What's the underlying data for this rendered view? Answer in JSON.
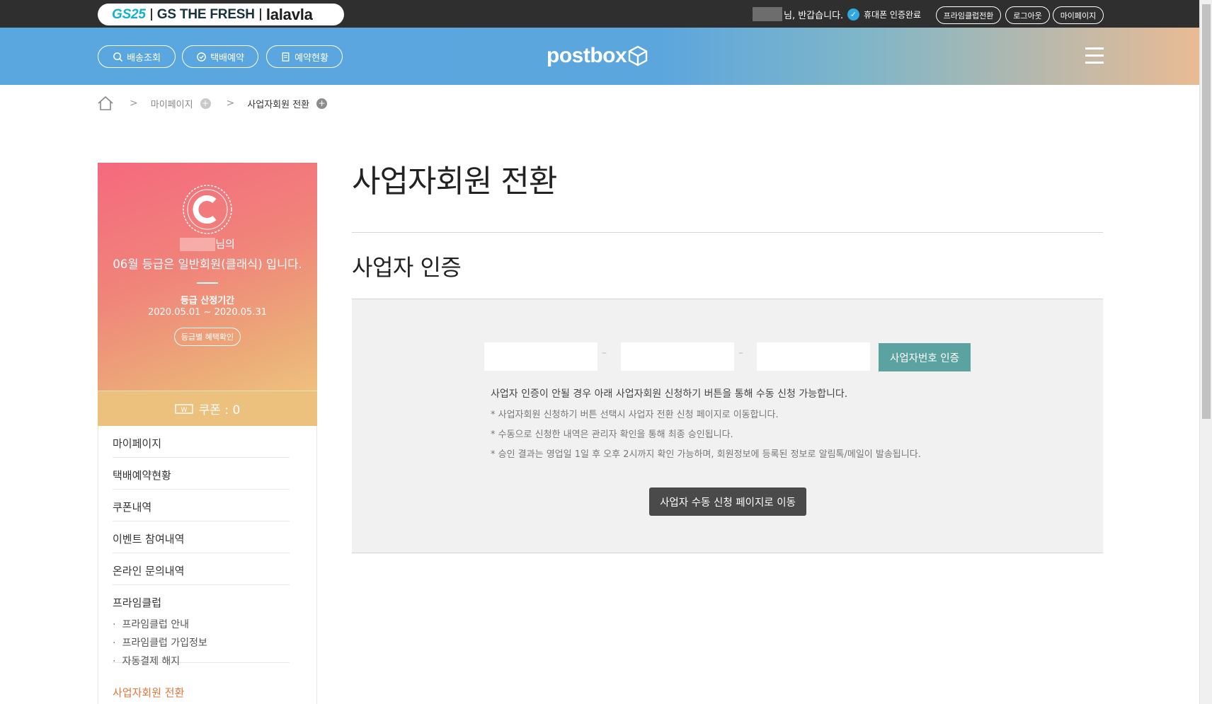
{
  "topbar": {
    "brands": {
      "gs25": "GS25",
      "fresh": "GS THE FRESH",
      "lalavla": "lalavla"
    },
    "greeting": "님, 반갑습니다.",
    "verified": "휴대폰 인증완료",
    "buttons": {
      "prime": "프라임클럽전환",
      "logout": "로그아웃",
      "mypage": "마이페이지"
    }
  },
  "header": {
    "nav": {
      "tracking": "배송조회",
      "reserve": "택배예약",
      "status": "예약현황"
    },
    "logo": "postbox"
  },
  "breadcrumb": {
    "level1": "마이페이지",
    "level2": "사업자회원 전환"
  },
  "profile": {
    "name_suffix": "님의",
    "grade": "06월 등급은 일반회원(클래식) 입니다.",
    "period_title": "등급 산정기간",
    "period": "2020.05.01 ~ 2020.05.31",
    "benefit_button": "등급별 혜택확인",
    "coupon": "쿠폰 : 0"
  },
  "side_menu": {
    "items": [
      "마이페이지",
      "택배예약현황",
      "쿠폰내역",
      "이벤트 참여내역",
      "온라인 문의내역",
      "프라임클럽"
    ],
    "sub_items": [
      "프라임클럽 안내",
      "프라임클럽 가입정보",
      "자동결제 해지"
    ],
    "active": "사업자회원 전환"
  },
  "main": {
    "title": "사업자회원 전환",
    "section_title": "사업자 인증",
    "inputs": [
      {
        "value": "",
        "placeholder": ""
      },
      {
        "value": "",
        "placeholder": ""
      },
      {
        "value": "",
        "placeholder": ""
      }
    ],
    "separator": "–",
    "verify_button": "사업자번호 인증",
    "notes": [
      "사업자 인증이 안될 경우 아래 사업자회원 신청하기 버튼을 통해 수동 신청 가능합니다.",
      "* 사업자회원 신청하기 버튼 선택시 사업자 전환 신청 페이지로 이동합니다.",
      "* 수동으로 신청한 내역은 관리자 확인을 통해 최종 승인됩니다.",
      "* 승인 결과는 영업일 1일 후 오후 2시까지 확인 가능하며, 회원정보에 등록된 정보로 알림톡/메일이 발송됩니다."
    ],
    "manual_button": "사업자 수동 신청 페이지로 이동"
  },
  "colors": {
    "topbar": "#2f2f2f",
    "header_blue": "#5aa6df",
    "verify_button": "#5aa3a0",
    "manual_button": "#4a4a4a",
    "active_menu": "#e0773a"
  },
  "icons": [
    "search-icon",
    "clock-icon",
    "document-icon",
    "box-logo-icon",
    "hamburger-icon",
    "home-icon",
    "check-icon",
    "classic-badge-icon",
    "coupon-icon"
  ]
}
